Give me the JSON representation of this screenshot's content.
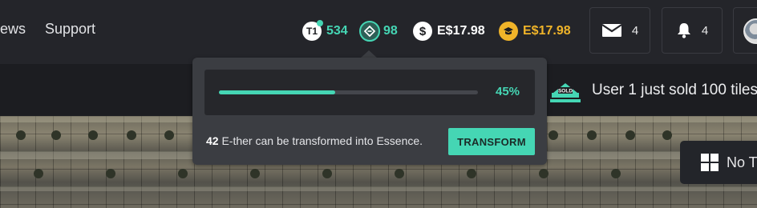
{
  "nav": {
    "news_label": "ews",
    "support_label": "Support"
  },
  "stats": {
    "tier": {
      "icon": "tier-badge-icon",
      "badge_text": "T1",
      "value": "534",
      "color": "#45d6b4"
    },
    "essence": {
      "icon": "essence-icon",
      "value": "98",
      "color": "#45d6b4"
    },
    "ether": {
      "icon": "dollar-coin-icon",
      "value": "E$17.98",
      "color": "#ffffff"
    },
    "gold": {
      "icon": "gold-coin-icon",
      "value": "E$17.98",
      "color": "#f0b429"
    }
  },
  "header_buttons": {
    "messages": {
      "icon": "mail-icon",
      "count": "4"
    },
    "notifications": {
      "icon": "bell-icon",
      "count": "4"
    }
  },
  "ticker": {
    "icon": "sold-icon",
    "logo_text": "SOLD",
    "text": "User 1 just sold 100 tiles"
  },
  "popover": {
    "progress_fraction": 0.45,
    "progress_label": "45%",
    "description_count": "42",
    "description_text": " E-ther can be transformed into Essence.",
    "button_label": "TRANSFORM"
  },
  "map_overlay": {
    "icon": "grid-icon",
    "label": "No T"
  },
  "colors": {
    "accent": "#45d6b4",
    "gold": "#f0b429",
    "background": "#24252a"
  }
}
